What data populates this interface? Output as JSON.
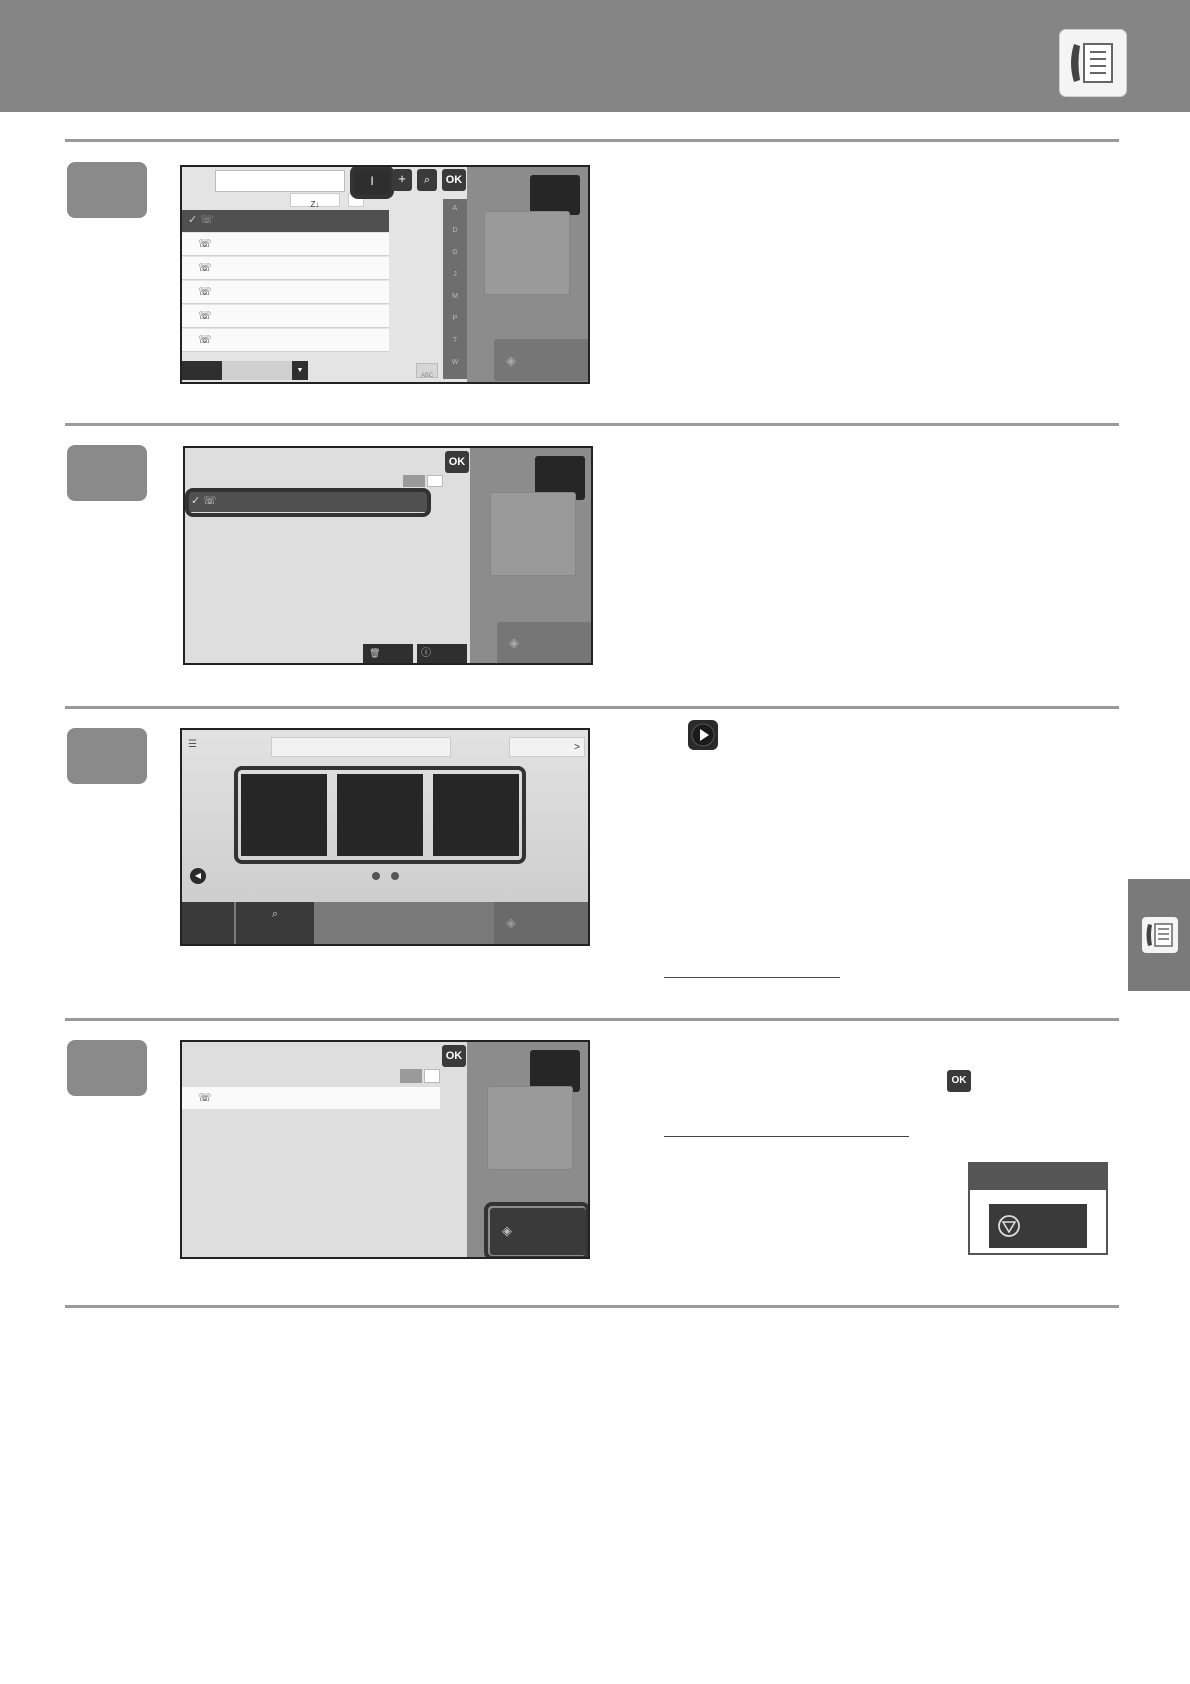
{
  "header": {
    "icon": "fax-address-book-icon"
  },
  "step1": {
    "sort_label": "Z↓",
    "ok_label": "OK",
    "plus_label": "+",
    "index_letters": [
      "A",
      "D",
      "G",
      "J",
      "M",
      "P",
      "T",
      "W"
    ],
    "tab_label": "ABC"
  },
  "step2": {
    "ok_label": "OK"
  },
  "step3": {
    "next_label": ">"
  },
  "step4": {
    "ok_label": "OK",
    "inline_ok_label": "OK"
  },
  "side_tab": {
    "icon": "fax-address-book-icon"
  }
}
